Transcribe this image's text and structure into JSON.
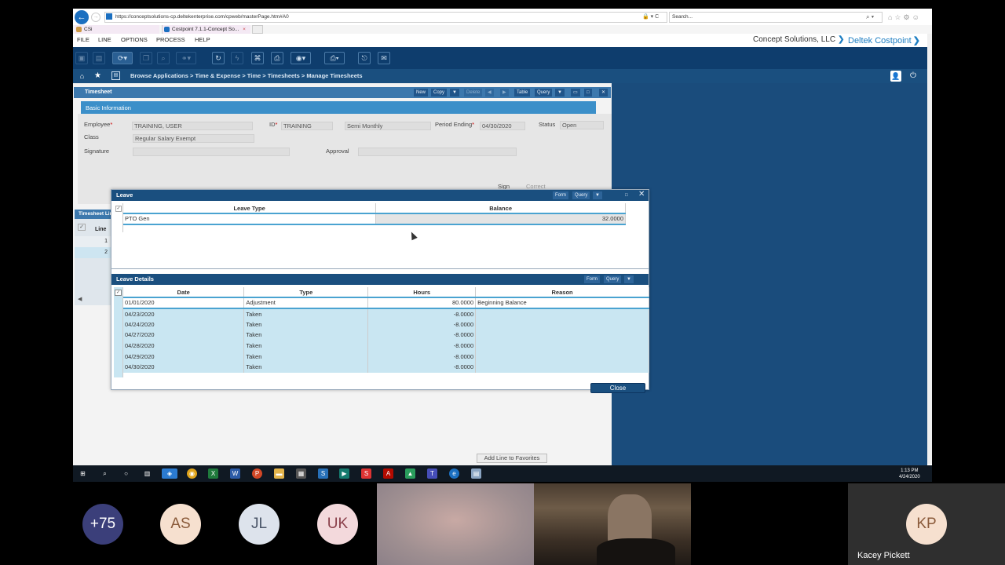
{
  "browser": {
    "address": "https://conceptsolutions-cp.deltekenterprise.com/cpweb/masterPage.htm#A0",
    "address_right": "🔒 ▾ C",
    "search_placeholder": "Search...",
    "tabs": [
      {
        "label": "CSi"
      },
      {
        "label": "Costpoint 7.1.1-Concept So...",
        "close": "×"
      }
    ]
  },
  "menu": {
    "items": [
      "FILE",
      "LINE",
      "OPTIONS",
      "PROCESS",
      "HELP"
    ],
    "company": "Concept Solutions, LLC",
    "brand": "Deltek Costpoint"
  },
  "breadcrumb": {
    "text": "Browse Applications  >  Time & Expense  >  Time  >  Timesheets  >  Manage Timesheets"
  },
  "timesheet": {
    "title": "Timesheet",
    "buttons": [
      "New",
      "Copy",
      "Delete",
      "Table",
      "Query"
    ],
    "section": "Basic Information",
    "employee_label": "Employee",
    "employee_value": "TRAINING, USER",
    "id_label": "ID",
    "id_value": "TRAINING",
    "period_type": "Semi Monthly",
    "period_ending_label": "Period Ending",
    "period_ending_value": "04/30/2020",
    "status_label": "Status",
    "status_value": "Open",
    "class_label": "Class",
    "class_value": "Regular Salary Exempt",
    "signature_label": "Signature",
    "approval_label": "Approval",
    "sign_label": "Sign",
    "correct_label": "Correct",
    "lines_title": "Timesheet Lines",
    "line_header": "Line",
    "line_numbers": [
      "1",
      "2"
    ],
    "add_favorites": "Add Line to Favorites"
  },
  "leave": {
    "title": "Leave",
    "buttons": [
      "Form",
      "Query"
    ],
    "columns": [
      "Leave Type",
      "Balance"
    ],
    "rows": [
      {
        "type": "PTO Gen",
        "balance": "32.0000"
      }
    ]
  },
  "leave_details": {
    "title": "Leave Details",
    "buttons": [
      "Form",
      "Query"
    ],
    "columns": [
      "Date",
      "Type",
      "Hours",
      "Reason"
    ],
    "rows": [
      {
        "date": "01/01/2020",
        "type": "Adjustment",
        "hours": "80.0000",
        "reason": "Beginning Balance"
      },
      {
        "date": "04/23/2020",
        "type": "Taken",
        "hours": "-8.0000",
        "reason": ""
      },
      {
        "date": "04/24/2020",
        "type": "Taken",
        "hours": "-8.0000",
        "reason": ""
      },
      {
        "date": "04/27/2020",
        "type": "Taken",
        "hours": "-8.0000",
        "reason": ""
      },
      {
        "date": "04/28/2020",
        "type": "Taken",
        "hours": "-8.0000",
        "reason": ""
      },
      {
        "date": "04/29/2020",
        "type": "Taken",
        "hours": "-8.0000",
        "reason": ""
      },
      {
        "date": "04/30/2020",
        "type": "Taken",
        "hours": "-8.0000",
        "reason": ""
      }
    ],
    "close_label": "Close"
  },
  "taskbar": {
    "time": "1:13 PM",
    "date": "4/24/2020"
  },
  "meeting": {
    "participants": [
      {
        "initials": "+75",
        "bg": "#3b3f7a",
        "fg": "#ffffff"
      },
      {
        "initials": "AS",
        "bg": "#f6e0cf",
        "fg": "#8a5a3a"
      },
      {
        "initials": "JL",
        "bg": "#dde3ec",
        "fg": "#4a5568"
      },
      {
        "initials": "UK",
        "bg": "#f3d9dc",
        "fg": "#8a3f4a"
      }
    ],
    "kp_initials": "KP",
    "kp_name": "Kacey Pickett"
  },
  "colors": {
    "toolbar": "#0e3d6d",
    "dialog_title": "#1a4f7f",
    "selected_row": "#c9e6f2",
    "accent": "#1d7ec2"
  }
}
